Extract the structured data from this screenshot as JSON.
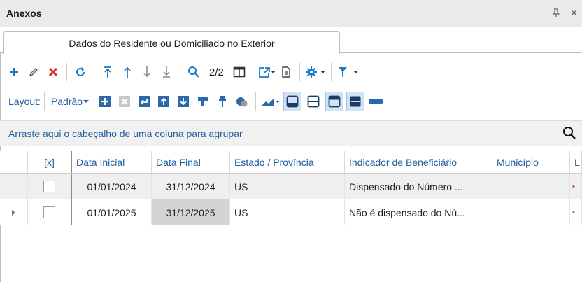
{
  "panel": {
    "title": "Anexos",
    "pin_glyph": "↑",
    "close_glyph": "✕"
  },
  "tabs": [
    {
      "label": "Dados do Residente ou Domiciliado no Exterior"
    }
  ],
  "toolbar": {
    "pager": "2/2"
  },
  "layout_bar": {
    "label": "Layout:",
    "value": "Padrão"
  },
  "groupbar": {
    "hint": "Arraste aqui o cabeçalho de uma coluna para agrupar"
  },
  "grid": {
    "columns": [
      "[x]",
      "Data Inicial",
      "Data Final",
      "Estado / Província",
      "Indicador de Beneficiário",
      "Município",
      "L"
    ],
    "rows": [
      {
        "data_inicial": "01/01/2024",
        "data_final": "31/12/2024",
        "estado": "US",
        "indicador": "Dispensado do Número ...",
        "municipio": ""
      },
      {
        "data_inicial": "01/01/2025",
        "data_final": "31/12/2025",
        "estado": "US",
        "indicador": "Não é dispensado do Nú...",
        "municipio": ""
      }
    ]
  },
  "colors": {
    "accent": "#1e5f9e",
    "add": "#1a7ac8",
    "delete": "#d9262b",
    "selected": "#cfe2f6"
  },
  "icons": [
    "add-icon",
    "edit-icon",
    "delete-icon",
    "refresh-icon",
    "move-first-icon",
    "move-up-icon",
    "move-down-icon",
    "move-last-icon",
    "search-icon",
    "columns-icon",
    "export-icon",
    "document-icon",
    "settings-icon",
    "filter-icon"
  ]
}
